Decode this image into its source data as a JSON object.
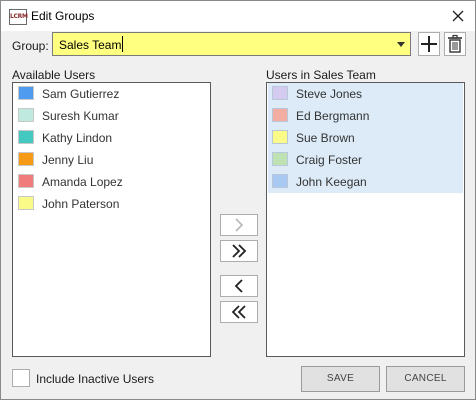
{
  "window": {
    "title": "Edit Groups",
    "app_icon_text": "LCRM"
  },
  "group": {
    "label": "Group:",
    "value": "Sales Team",
    "highlight_color": "#ffff80"
  },
  "available": {
    "label": "Available Users",
    "items": [
      {
        "name": "Sam Gutierrez",
        "color": "#4f9bf0"
      },
      {
        "name": "Suresh Kumar",
        "color": "#bfe8de"
      },
      {
        "name": "Kathy Lindon",
        "color": "#44c9c0"
      },
      {
        "name": "Jenny Liu",
        "color": "#f59b18"
      },
      {
        "name": "Amanda Lopez",
        "color": "#f07c7c"
      },
      {
        "name": "John Paterson",
        "color": "#fafa88"
      }
    ]
  },
  "members": {
    "label": "Users in Sales Team",
    "items": [
      {
        "name": "Steve Jones",
        "color": "#d4ccf0"
      },
      {
        "name": "Ed Bergmann",
        "color": "#f2aca2"
      },
      {
        "name": "Sue Brown",
        "color": "#fafa88"
      },
      {
        "name": "Craig Foster",
        "color": "#bfe2b4"
      },
      {
        "name": "John Keegan",
        "color": "#a9c9f2"
      }
    ]
  },
  "options": {
    "include_inactive_label": "Include Inactive Users",
    "include_inactive_checked": false
  },
  "buttons": {
    "save_label": "SAVE",
    "cancel_label": "CANCEL"
  },
  "icons": {
    "close": "close-icon",
    "add": "plus-icon",
    "delete": "trash-icon",
    "add_selected": "chevron-right-icon",
    "add_all": "double-chevron-right-icon",
    "remove_selected": "chevron-left-icon",
    "remove_all": "double-chevron-left-icon"
  }
}
